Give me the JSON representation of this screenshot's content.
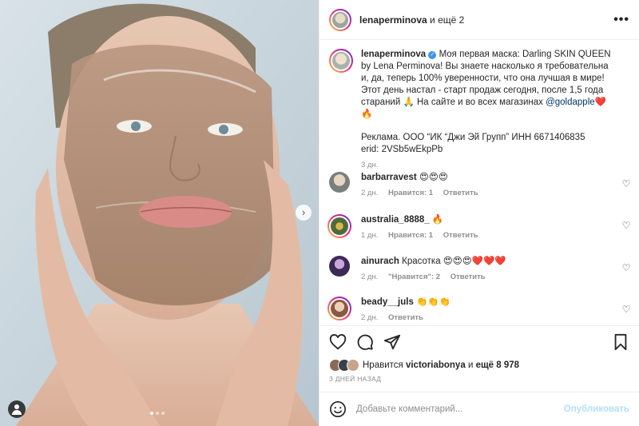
{
  "post": {
    "image_description_icon": "photo",
    "next_icon": "chevron-right-icon"
  },
  "header": {
    "username": "lenaperminova",
    "coauthors": "и ещё 2",
    "more_icon": "•••"
  },
  "caption": {
    "username": "lenaperminova",
    "text_before_link": "Моя первая маска: Darling SKIN QUEEN by Lena Perminova! Вы знаете насколько я требовательна и, да, теперь 100% уверенности, что она лучшая в мире! Этот день настал - старт продаж сегодня, после 1,5 года стараний 🙏 На сайте и во всех магазинах ",
    "link": "@goldapple",
    "text_after_link": "❤️🔥",
    "ad_line": "Реклама. ООО “ИК “Джи Эй Групп” ИНН 6671406835",
    "erid_line": "erid: 2VSb5wEkpPb",
    "time": "3 дн."
  },
  "comments": [
    {
      "username": "barbarravest",
      "text": "😍😍😍",
      "time": "2 дн.",
      "likes": "Нравится: 1",
      "reply": "Ответить"
    },
    {
      "username": "australia_8888_",
      "text": "🔥",
      "time": "1 дн.",
      "likes": "Нравится: 1",
      "reply": "Ответить"
    },
    {
      "username": "ainurach",
      "text": "Красотка 😍😍😍❤️❤️❤️",
      "time": "2 дн.",
      "likes": "\"Нравится\": 2",
      "reply": "Ответить"
    },
    {
      "username": "beady__juls",
      "text": "👏👏👏",
      "time": "2 дн.",
      "likes": "",
      "reply": "Ответить"
    }
  ],
  "likes": {
    "prefix": "Нравится",
    "user": "victoriabonya",
    "and": "и",
    "others": "ещё 8 978"
  },
  "time_ago": "3 ДНЕЙ НАЗАД",
  "add_comment": {
    "placeholder": "Добавьте комментарий...",
    "publish": "Опубликовать"
  },
  "colors": {
    "link": "#00376b",
    "verified": "#3897f0",
    "publish_disabled": "#b2dffc",
    "muted": "#8e8e8e"
  }
}
